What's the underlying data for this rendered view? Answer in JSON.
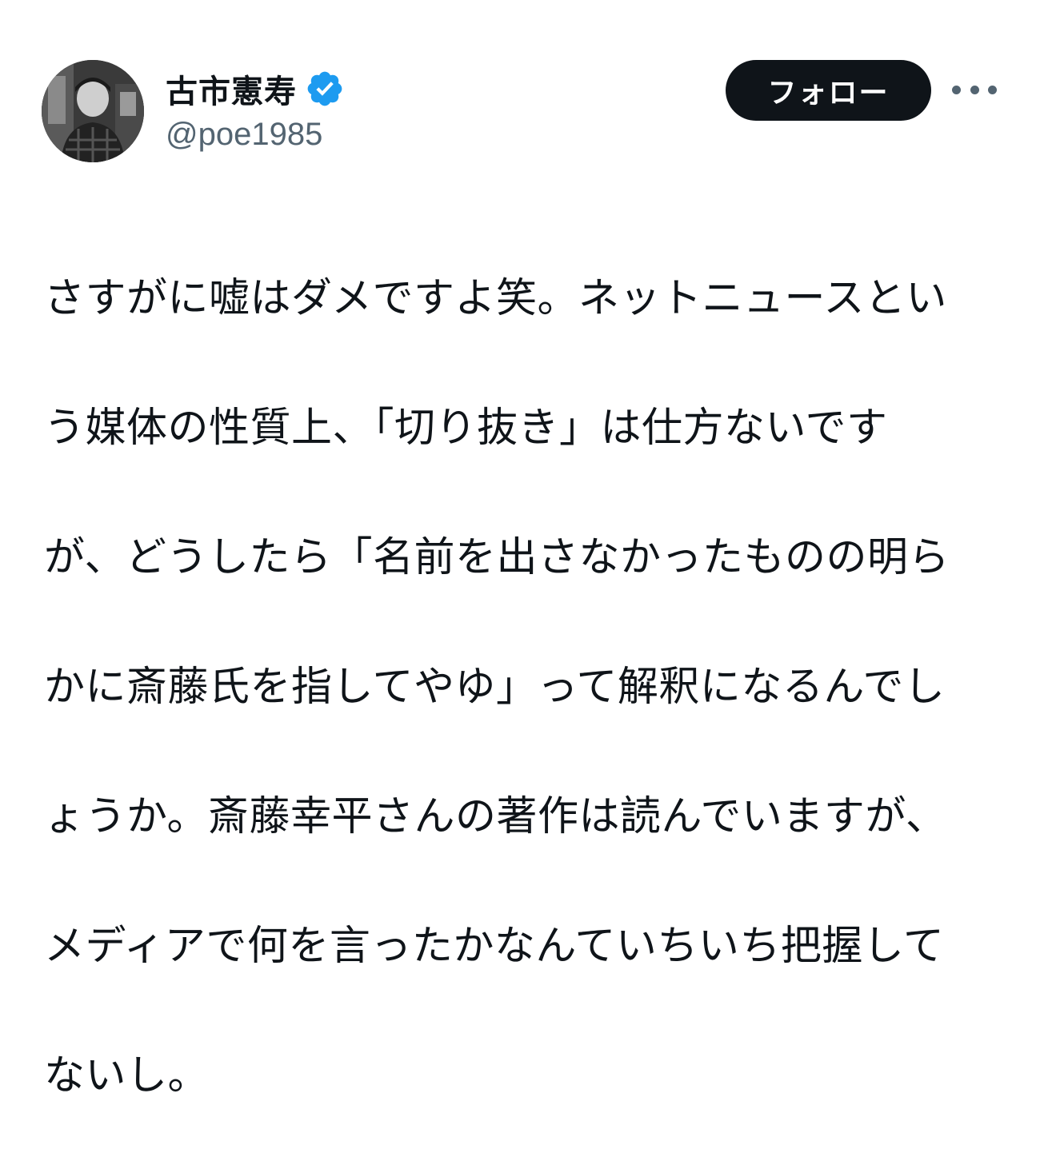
{
  "author": {
    "display_name": "古市憲寿",
    "handle": "@poe1985",
    "verified_icon": "verified-badge-icon",
    "verified_color": "#1d9bf0"
  },
  "actions": {
    "follow_label": "フォロー",
    "more_icon": "more-horizontal-icon"
  },
  "tweet": {
    "lines": [
      "さすがに嘘はダメですよ笑。ネットニュースとい",
      "う媒体の性質上、「切り抜き」は仕方ないです",
      "が、どうしたら「名前を出さなかったものの明ら",
      "かに斎藤氏を指してやゆ」って解釈になるんでし",
      "ょうか。斎藤幸平さんの著作は読んでいますが、",
      "メディアで何を言ったかなんていちいち把握して",
      "ないし。"
    ]
  }
}
